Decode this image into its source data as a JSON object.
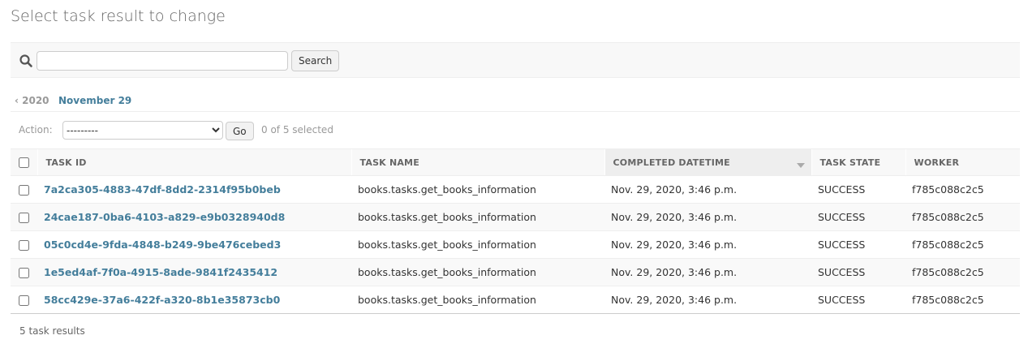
{
  "page": {
    "title": "Select task result to change"
  },
  "search": {
    "value": "",
    "placeholder": "",
    "button_label": "Search"
  },
  "date_hierarchy": {
    "back_label": "‹ 2020",
    "current_label": "November 29"
  },
  "actions": {
    "label": "Action:",
    "selected_option": "---------",
    "go_label": "Go",
    "selected_count": "0 of 5 selected"
  },
  "table": {
    "columns": [
      "Task ID",
      "Task name",
      "Completed datetime",
      "Task state",
      "Worker"
    ],
    "sorted_column": "Completed datetime",
    "rows": [
      {
        "task_id": "7a2ca305-4883-47df-8dd2-2314f95b0beb",
        "task_name": "books.tasks.get_books_information",
        "completed": "Nov. 29, 2020, 3:46 p.m.",
        "state": "SUCCESS",
        "worker": "f785c088c2c5"
      },
      {
        "task_id": "24cae187-0ba6-4103-a829-e9b0328940d8",
        "task_name": "books.tasks.get_books_information",
        "completed": "Nov. 29, 2020, 3:46 p.m.",
        "state": "SUCCESS",
        "worker": "f785c088c2c5"
      },
      {
        "task_id": "05c0cd4e-9fda-4848-b249-9be476cebed3",
        "task_name": "books.tasks.get_books_information",
        "completed": "Nov. 29, 2020, 3:46 p.m.",
        "state": "SUCCESS",
        "worker": "f785c088c2c5"
      },
      {
        "task_id": "1e5ed4af-7f0a-4915-8ade-9841f2435412",
        "task_name": "books.tasks.get_books_information",
        "completed": "Nov. 29, 2020, 3:46 p.m.",
        "state": "SUCCESS",
        "worker": "f785c088c2c5"
      },
      {
        "task_id": "58cc429e-37a6-422f-a320-8b1e35873cb0",
        "task_name": "books.tasks.get_books_information",
        "completed": "Nov. 29, 2020, 3:46 p.m.",
        "state": "SUCCESS",
        "worker": "f785c088c2c5"
      }
    ]
  },
  "paginator": {
    "text": "5 task results"
  },
  "icons": {
    "search": "search-icon",
    "sort": "sort-descending-icon"
  },
  "colors": {
    "link": "#447e9b",
    "muted": "#999999",
    "header_bg": "#f8f8f8"
  }
}
